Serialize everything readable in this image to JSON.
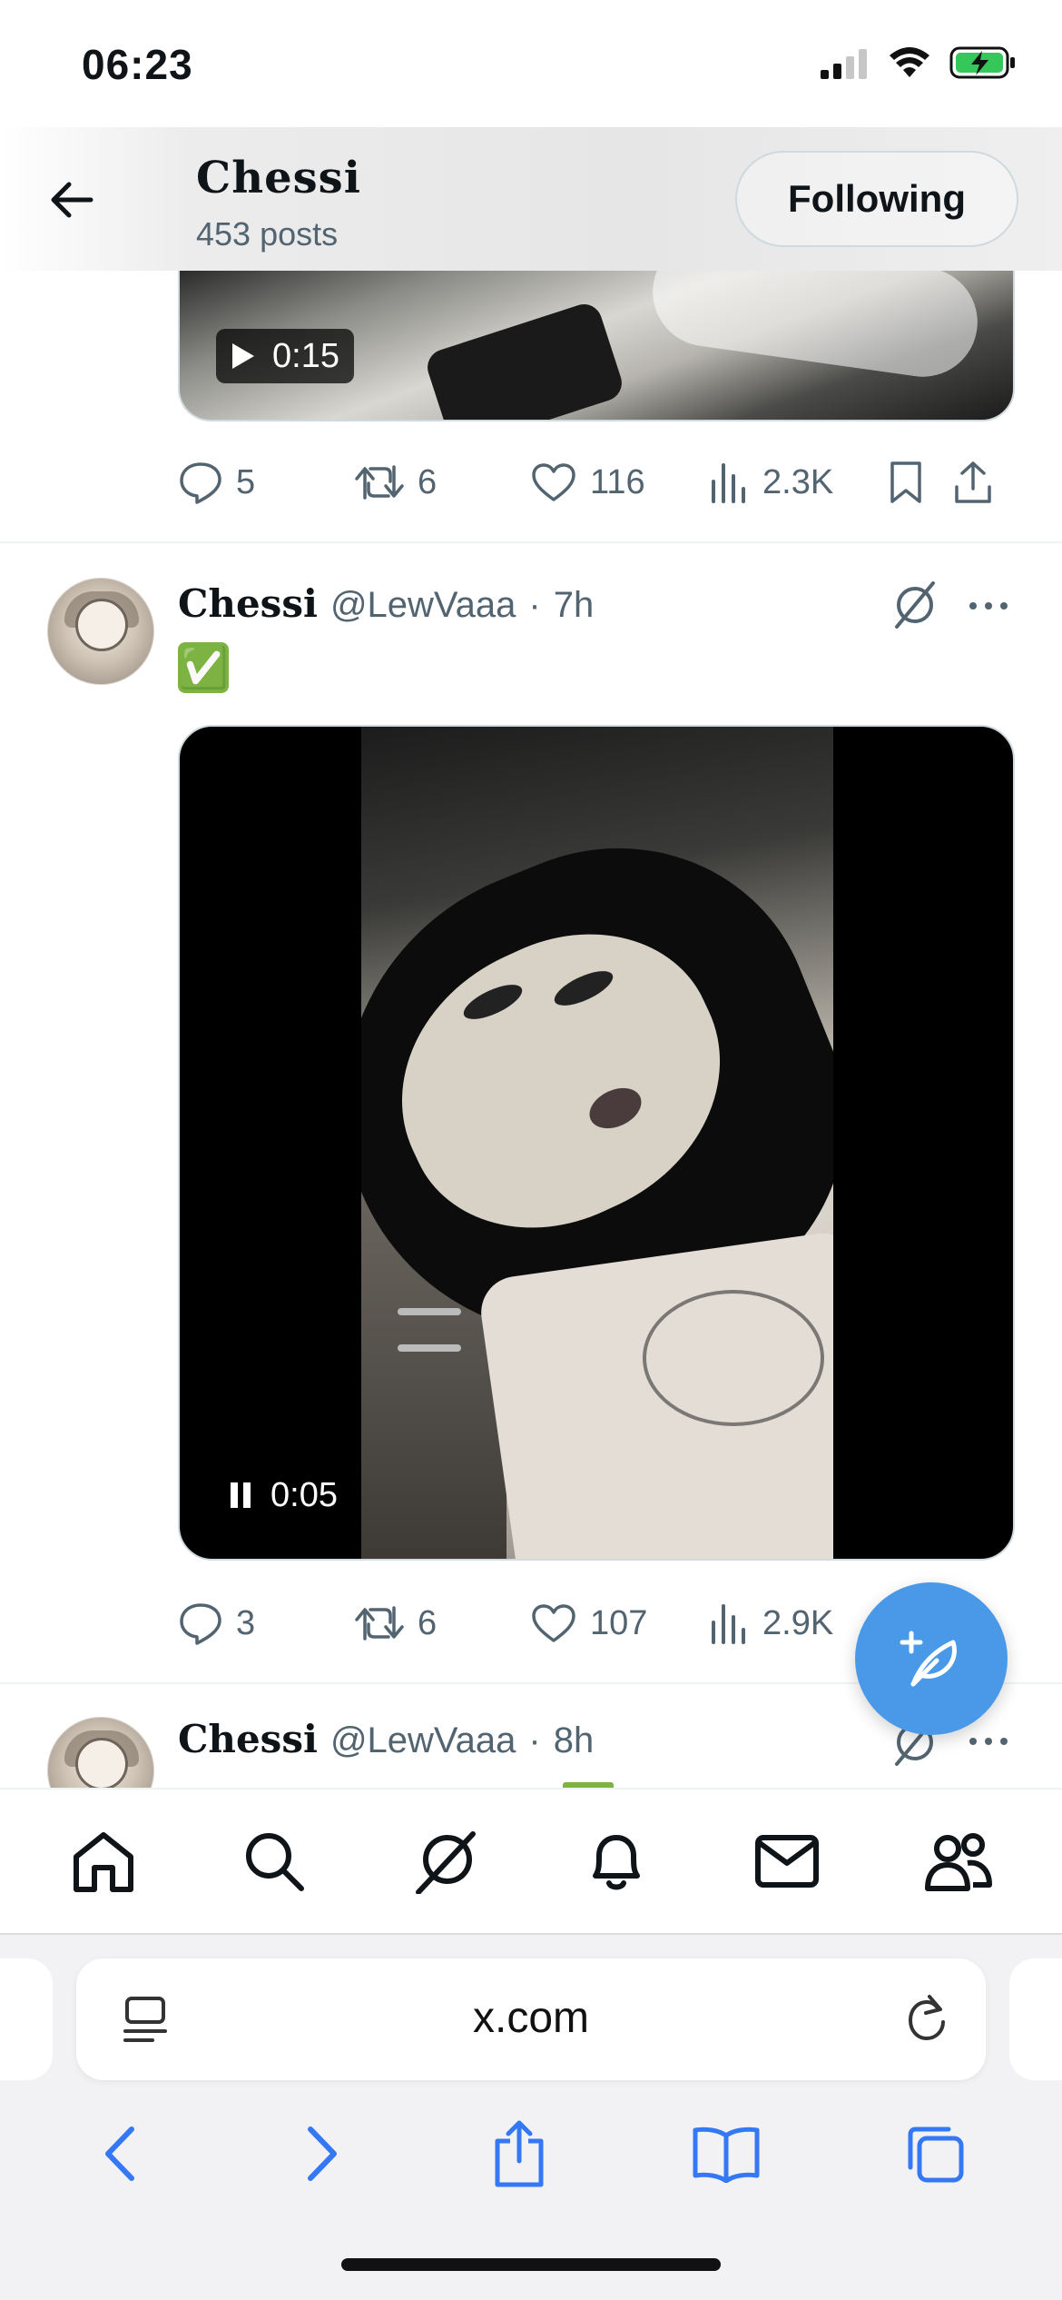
{
  "status_bar": {
    "time": "06:23"
  },
  "profile_header": {
    "name": "Chessi",
    "posts_count": "453 posts",
    "follow_button": "Following"
  },
  "previous_tweet": {
    "video_duration": "0:15",
    "stats": {
      "replies": "5",
      "reposts": "6",
      "likes": "116",
      "views": "2.3K"
    }
  },
  "tweet": {
    "display_name": "Chessi",
    "handle": "@LewVaaa",
    "separator": "·",
    "time": "7h",
    "text": "✅",
    "video_duration": "0:05",
    "stats": {
      "replies": "3",
      "reposts": "6",
      "likes": "107",
      "views": "2.9K"
    }
  },
  "next_tweet": {
    "display_name": "Chessi",
    "handle": "@LewVaaa",
    "separator": "·",
    "time": "8h"
  },
  "bottom_nav": [
    "home-icon",
    "search-icon",
    "grok-icon",
    "notifications-icon",
    "messages-icon",
    "communities-icon"
  ],
  "browser": {
    "url": "x.com"
  },
  "colors": {
    "accent": "#4a99e9",
    "muted_text": "#536471",
    "safari_blue": "#3478f6"
  }
}
